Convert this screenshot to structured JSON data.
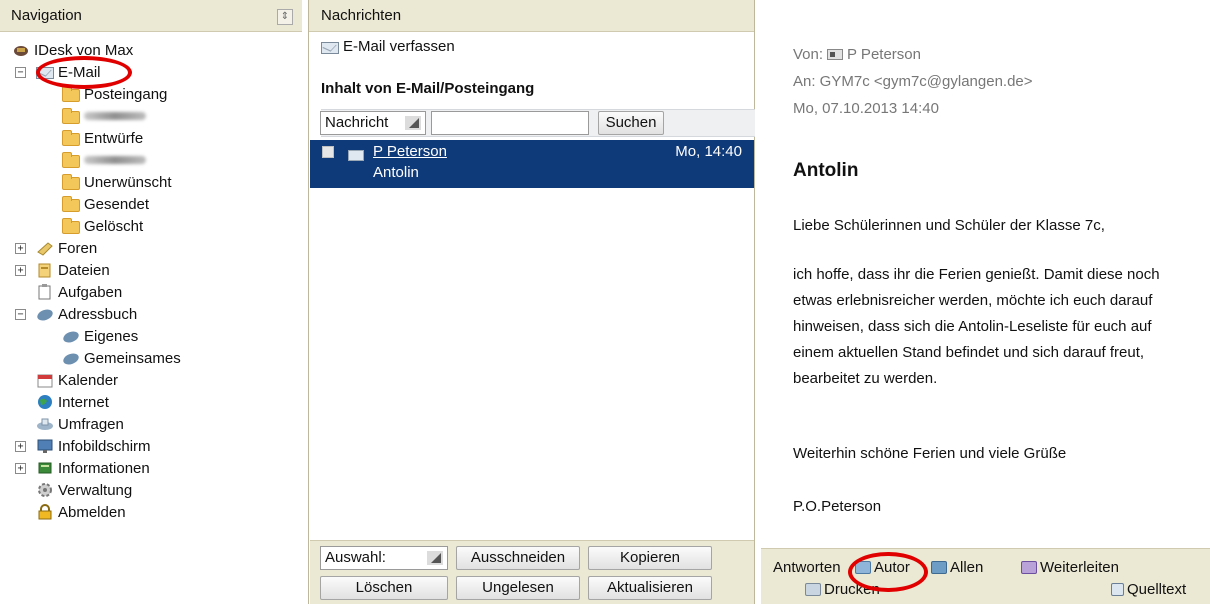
{
  "nav": {
    "title": "Navigation",
    "items": [
      {
        "label": "IDesk von Max"
      },
      {
        "label": "E-Mail"
      },
      {
        "label": "Posteingang"
      },
      {
        "label": ""
      },
      {
        "label": "Entwürfe"
      },
      {
        "label": ""
      },
      {
        "label": "Unerwünscht"
      },
      {
        "label": "Gesendet"
      },
      {
        "label": "Gelöscht"
      },
      {
        "label": "Foren"
      },
      {
        "label": "Dateien"
      },
      {
        "label": "Aufgaben"
      },
      {
        "label": "Adressbuch"
      },
      {
        "label": "Eigenes"
      },
      {
        "label": "Gemeinsames"
      },
      {
        "label": "Kalender"
      },
      {
        "label": "Internet"
      },
      {
        "label": "Umfragen"
      },
      {
        "label": "Infobildschirm"
      },
      {
        "label": "Informationen"
      },
      {
        "label": "Verwaltung"
      },
      {
        "label": "Abmelden"
      }
    ]
  },
  "messages": {
    "title": "Nachrichten",
    "compose_label": "E-Mail verfassen",
    "inbox_title": "Inhalt von E-Mail/Posteingang",
    "filter_select": "Nachricht",
    "search_value": "",
    "search_button": "Suchen",
    "list": [
      {
        "from": "P Peterson",
        "subject": "Antolin",
        "date": "Mo, 14:40"
      }
    ],
    "selection_select": "Auswahl:",
    "buttons": {
      "cut": "Ausschneiden",
      "copy": "Kopieren",
      "delete": "Löschen",
      "unread": "Ungelesen",
      "refresh": "Aktualisieren"
    }
  },
  "reader": {
    "from_prefix": "Von:",
    "from_name": "P Peterson",
    "to": "An: GYM7c <gym7c@gylangen.de>",
    "date": "Mo, 07.10.2013 14:40",
    "subject": "Antolin",
    "body": [
      "Liebe Schülerinnen und Schüler der Klasse 7c,",
      "ich hoffe, dass ihr die Ferien genießt. Damit diese noch etwas erlebnisreicher werden, möchte ich euch darauf hinweisen, dass sich die Antolin-Leseliste für euch auf einem aktuellen Stand befindet und sich darauf freut, bearbeitet zu werden.",
      "Weiterhin schöne Ferien und viele Grüße",
      "P.O.Peterson"
    ],
    "actions": {
      "reply": "Antworten",
      "author": "Autor",
      "all": "Allen",
      "forward": "Weiterleiten",
      "print": "Drucken",
      "source": "Quelltext"
    }
  },
  "colors": {
    "header_bg": "#ebe8d4",
    "selection_bg": "#0f3a7a",
    "highlight_ring": "#e10000",
    "folder": "#f4c75a"
  }
}
